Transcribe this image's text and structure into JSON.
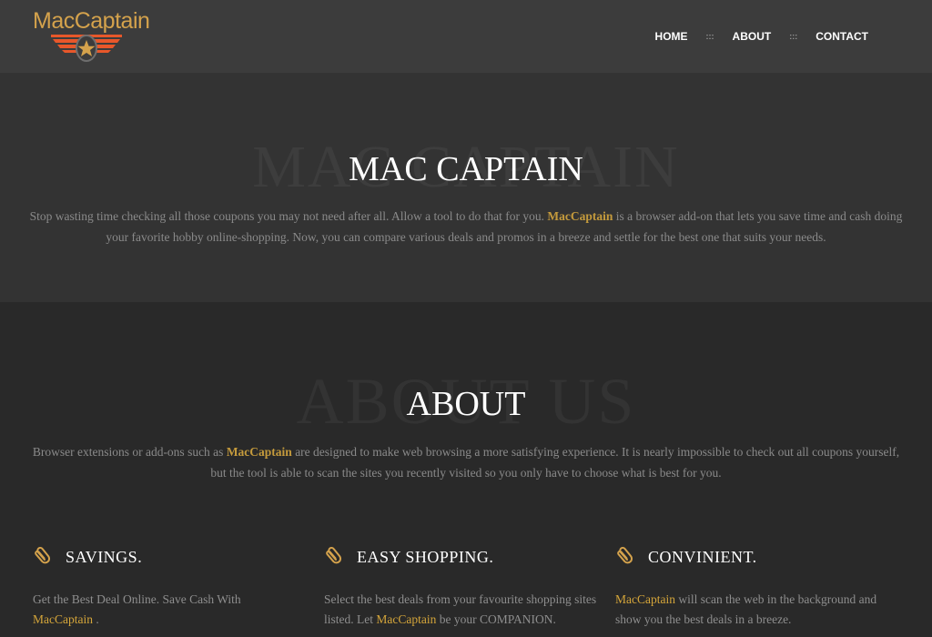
{
  "header": {
    "logo_text": "MacCaptain",
    "nav": [
      {
        "label": "HOME"
      },
      {
        "label": "ABOUT"
      },
      {
        "label": "CONTACT"
      }
    ],
    "nav_separator": ":::"
  },
  "hero": {
    "watermark": "MAC CAPTAIN",
    "title": "MAC CAPTAIN",
    "text_before": "Stop wasting time checking all those coupons you may not need after all. Allow a tool to do that for you.",
    "brand": "MacCaptain",
    "text_after": "is a browser add-on that lets you save time and cash doing your favorite hobby online-shopping. Now, you can compare various deals and promos in a breeze and settle for the best one that suits your needs."
  },
  "about": {
    "watermark": "ABOUT US",
    "title": "ABOUT",
    "text_before": "Browser extensions or add-ons such as",
    "brand": "MacCaptain",
    "text_after": "are designed to make web browsing a more satisfying experience. It is nearly impossible to check out all coupons yourself, but the tool is able to scan the sites you recently visited so you only have to choose what is best for you."
  },
  "features": [
    {
      "icon": "paperclip-icon",
      "title": "SAVINGS.",
      "text_before": "Get the Best Deal Online. Save Cash With",
      "brand": "MacCaptain",
      "text_after": "."
    },
    {
      "icon": "paperclip-icon",
      "title": "EASY SHOPPING.",
      "text_before": "Select the best deals from your favourite shopping sites listed. Let",
      "brand": "MacCaptain",
      "text_after": "be your COMPANION."
    },
    {
      "icon": "paperclip-icon",
      "title": "CONVINIENT.",
      "text_before": "",
      "brand": "MacCaptain",
      "text_after": "will scan the web in the background and show you the best deals in a breeze."
    }
  ],
  "colors": {
    "accent": "#d4a24c",
    "wing": "#e8572a",
    "header_bg": "#3c3c3c",
    "hero_bg": "#333333",
    "about_bg": "#292929"
  }
}
